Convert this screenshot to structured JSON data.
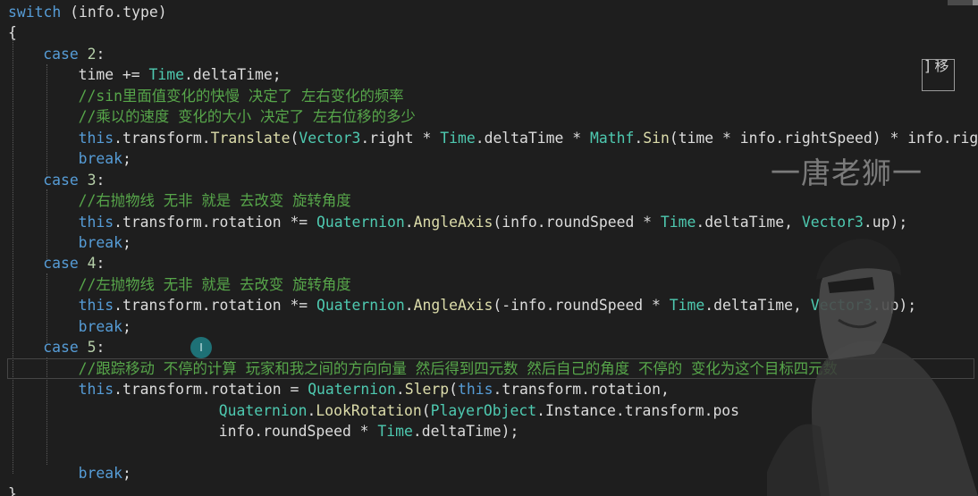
{
  "editor": {
    "lines": [
      {
        "indent": 0,
        "tokens": [
          {
            "t": "switch",
            "c": "kw"
          },
          {
            "t": " (info.type)",
            "c": "plain"
          }
        ]
      },
      {
        "indent": 0,
        "tokens": [
          {
            "t": "{",
            "c": "plain"
          }
        ]
      },
      {
        "indent": 1,
        "tokens": [
          {
            "t": "case",
            "c": "kw"
          },
          {
            "t": " ",
            "c": "plain"
          },
          {
            "t": "2",
            "c": "num"
          },
          {
            "t": ":",
            "c": "plain"
          }
        ]
      },
      {
        "indent": 2,
        "tokens": [
          {
            "t": "time += ",
            "c": "plain"
          },
          {
            "t": "Time",
            "c": "type"
          },
          {
            "t": ".deltaTime;",
            "c": "plain"
          }
        ]
      },
      {
        "indent": 2,
        "tokens": [
          {
            "t": "//sin里面值变化的快慢 决定了 左右变化的频率",
            "c": "comment"
          }
        ]
      },
      {
        "indent": 2,
        "tokens": [
          {
            "t": "//乘以的速度 变化的大小 决定了 左右位移的多少",
            "c": "comment"
          }
        ]
      },
      {
        "indent": 2,
        "tokens": [
          {
            "t": "this",
            "c": "kw"
          },
          {
            "t": ".transform.",
            "c": "plain"
          },
          {
            "t": "Translate",
            "c": "method"
          },
          {
            "t": "(",
            "c": "plain"
          },
          {
            "t": "Vector3",
            "c": "type"
          },
          {
            "t": ".right * ",
            "c": "plain"
          },
          {
            "t": "Time",
            "c": "type"
          },
          {
            "t": ".deltaTime * ",
            "c": "plain"
          },
          {
            "t": "Mathf",
            "c": "type"
          },
          {
            "t": ".",
            "c": "plain"
          },
          {
            "t": "Sin",
            "c": "method"
          },
          {
            "t": "(time * info.rightSpeed) * info.rig",
            "c": "plain"
          }
        ]
      },
      {
        "indent": 2,
        "tokens": [
          {
            "t": "break",
            "c": "kw"
          },
          {
            "t": ";",
            "c": "plain"
          }
        ]
      },
      {
        "indent": 1,
        "tokens": [
          {
            "t": "case",
            "c": "kw"
          },
          {
            "t": " ",
            "c": "plain"
          },
          {
            "t": "3",
            "c": "num"
          },
          {
            "t": ":",
            "c": "plain"
          }
        ]
      },
      {
        "indent": 2,
        "tokens": [
          {
            "t": "//右抛物线 无非 就是 去改变 旋转角度",
            "c": "comment"
          }
        ]
      },
      {
        "indent": 2,
        "tokens": [
          {
            "t": "this",
            "c": "kw"
          },
          {
            "t": ".transform.rotation *= ",
            "c": "plain"
          },
          {
            "t": "Quaternion",
            "c": "type"
          },
          {
            "t": ".",
            "c": "plain"
          },
          {
            "t": "AngleAxis",
            "c": "method"
          },
          {
            "t": "(info.roundSpeed * ",
            "c": "plain"
          },
          {
            "t": "Time",
            "c": "type"
          },
          {
            "t": ".deltaTime, ",
            "c": "plain"
          },
          {
            "t": "Vector3",
            "c": "type"
          },
          {
            "t": ".up);",
            "c": "plain"
          }
        ]
      },
      {
        "indent": 2,
        "tokens": [
          {
            "t": "break",
            "c": "kw"
          },
          {
            "t": ";",
            "c": "plain"
          }
        ]
      },
      {
        "indent": 1,
        "tokens": [
          {
            "t": "case",
            "c": "kw"
          },
          {
            "t": " ",
            "c": "plain"
          },
          {
            "t": "4",
            "c": "num"
          },
          {
            "t": ":",
            "c": "plain"
          }
        ]
      },
      {
        "indent": 2,
        "tokens": [
          {
            "t": "//左抛物线 无非 就是 去改变 旋转角度",
            "c": "comment"
          }
        ]
      },
      {
        "indent": 2,
        "tokens": [
          {
            "t": "this",
            "c": "kw"
          },
          {
            "t": ".transform.rotation *= ",
            "c": "plain"
          },
          {
            "t": "Quaternion",
            "c": "type"
          },
          {
            "t": ".",
            "c": "plain"
          },
          {
            "t": "AngleAxis",
            "c": "method"
          },
          {
            "t": "(-info.roundSpeed * ",
            "c": "plain"
          },
          {
            "t": "Time",
            "c": "type"
          },
          {
            "t": ".deltaTime, ",
            "c": "plain"
          },
          {
            "t": "Vector3",
            "c": "type"
          },
          {
            "t": ".up);",
            "c": "plain"
          }
        ]
      },
      {
        "indent": 2,
        "tokens": [
          {
            "t": "break",
            "c": "kw"
          },
          {
            "t": ";",
            "c": "plain"
          }
        ]
      },
      {
        "indent": 1,
        "tokens": [
          {
            "t": "case",
            "c": "kw"
          },
          {
            "t": " ",
            "c": "plain"
          },
          {
            "t": "5",
            "c": "num"
          },
          {
            "t": ":",
            "c": "plain"
          }
        ]
      },
      {
        "indent": 2,
        "tokens": [
          {
            "t": "//跟踪移动 不停的计算 玩家和我之间的方向向量 然后得到四元数 然后自己的角度 不停的 变化为这个目标四元数",
            "c": "comment"
          }
        ]
      },
      {
        "indent": 2,
        "tokens": [
          {
            "t": "this",
            "c": "kw"
          },
          {
            "t": ".transform.rotation = ",
            "c": "plain"
          },
          {
            "t": "Quaternion",
            "c": "type"
          },
          {
            "t": ".",
            "c": "plain"
          },
          {
            "t": "Slerp",
            "c": "method"
          },
          {
            "t": "(",
            "c": "plain"
          },
          {
            "t": "this",
            "c": "kw"
          },
          {
            "t": ".transform.rotation,",
            "c": "plain"
          }
        ]
      },
      {
        "indent": 6,
        "tokens": [
          {
            "t": "Quaternion",
            "c": "type"
          },
          {
            "t": ".",
            "c": "plain"
          },
          {
            "t": "LookRotation",
            "c": "method"
          },
          {
            "t": "(",
            "c": "plain"
          },
          {
            "t": "PlayerObject",
            "c": "type"
          },
          {
            "t": ".Instance.transform.pos",
            "c": "plain"
          }
        ]
      },
      {
        "indent": 6,
        "tokens": [
          {
            "t": "info.roundSpeed * ",
            "c": "plain"
          },
          {
            "t": "Time",
            "c": "type"
          },
          {
            "t": ".deltaTime);",
            "c": "plain"
          }
        ]
      },
      {
        "indent": 2,
        "tokens": []
      },
      {
        "indent": 2,
        "tokens": [
          {
            "t": "break",
            "c": "kw"
          },
          {
            "t": ";",
            "c": "plain"
          }
        ]
      },
      {
        "indent": 0,
        "tokens": [
          {
            "t": "}",
            "c": "plain"
          }
        ]
      }
    ]
  },
  "watermark": {
    "text": "一唐老狮一"
  },
  "minimap": {
    "text": "] 移"
  },
  "cursor": {
    "icon": "text-cursor-icon",
    "glyph": "I"
  },
  "colors": {
    "background": "#1e1e1e",
    "keyword": "#569cd6",
    "type": "#4ec9b0",
    "method": "#dcdcaa",
    "comment": "#57a64a",
    "number": "#b5cea8",
    "text": "#dcdcdc"
  }
}
